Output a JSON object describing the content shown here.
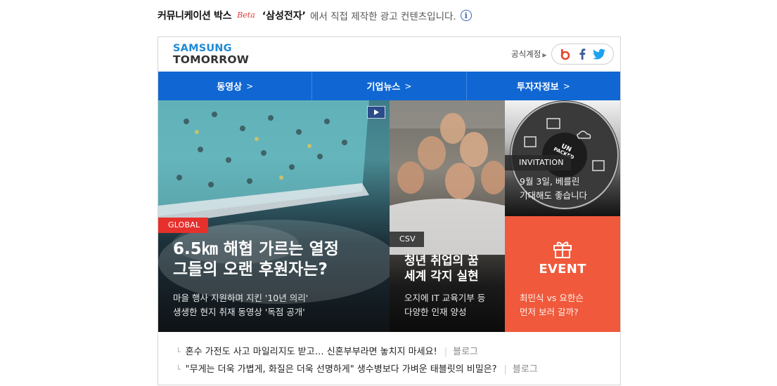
{
  "top": {
    "brand": "커뮤니케이션 박스",
    "beta": "Beta",
    "company": "‘삼성전자’",
    "rest": "에서 직접 제작한 광고 컨텐츠입니다.",
    "info_icon": "info-icon"
  },
  "header": {
    "logo_line1": "SAMSUNG",
    "logo_line2": "TOMORROW",
    "official": "공식계정",
    "social": [
      "blog-icon",
      "facebook-icon",
      "twitter-icon"
    ]
  },
  "nav": [
    {
      "label": "동영상"
    },
    {
      "label": "기업뉴스"
    },
    {
      "label": "투자자정보"
    }
  ],
  "tiles": {
    "global": {
      "tag": "GLOBAL",
      "headline1": "6.5㎞ 해협 가르는 열정",
      "headline2": "그들의 오랜 후원자는?",
      "sub1": "마을 행사 지원하며 지킨 '10년 의리'",
      "sub2": "생생한 현지 취재 동영상 '독점 공개'"
    },
    "csv": {
      "tag": "CSV",
      "headline1": "청년 취업의 꿈",
      "headline2": "세계 각지 실현",
      "sub1": "오지에 IT 교육기부 등",
      "sub2": "다양한 인재 양성"
    },
    "invitation": {
      "tag": "INVITATION",
      "sub1": "9월 3일, 베를린",
      "sub2": "기대해도 좋습니다",
      "badge_line1": "UN",
      "badge_line2": "PACKED"
    },
    "event": {
      "label": "EVENT",
      "sub1": "최민식 vs 요한슨",
      "sub2": "먼저 보러 갈까?"
    }
  },
  "bottom_links": [
    {
      "text": "혼수 가전도 사고 마일리지도 받고… 신혼부부라면 놓치지 마세요!",
      "category": "블로그"
    },
    {
      "text": "\"무게는 더욱 가볍게, 화질은 더욱 선명하게\" 생수병보다 가벼운 태블릿의 비밀은?",
      "category": "블로그"
    }
  ]
}
